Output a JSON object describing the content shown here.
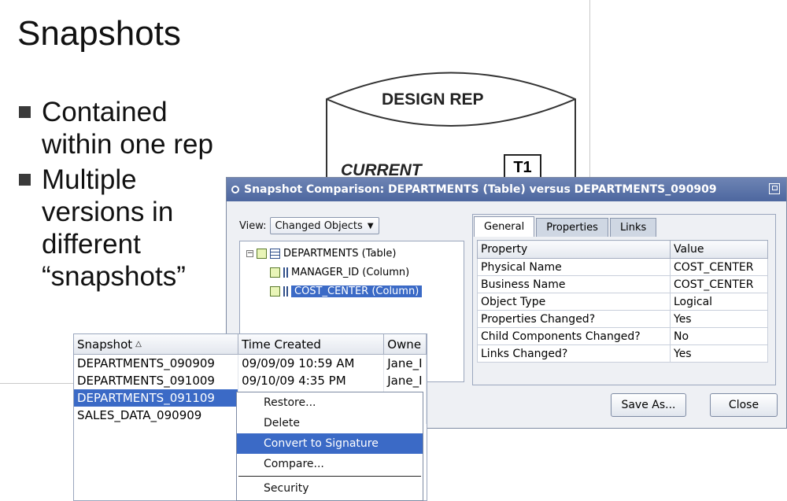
{
  "slide": {
    "title": "Snapshots",
    "bullets": [
      "Contained\nwithin one rep",
      "Multiple\nversions in\ndifferent\n“snapshots”"
    ],
    "cylinder_label": "DESIGN REP",
    "current_label": "CURRENT",
    "t1_label": "T1"
  },
  "dialog": {
    "title": "Snapshot Comparison: DEPARTMENTS (Table) versus DEPARTMENTS_090909",
    "view_label": "View:",
    "view_value": "Changed Objects",
    "tree": [
      {
        "label": "DEPARTMENTS (Table)"
      },
      {
        "label": "MANAGER_ID (Column)"
      },
      {
        "label": "COST_CENTER (Column)"
      }
    ],
    "tabs": [
      "General",
      "Properties",
      "Links"
    ],
    "table": {
      "headers": [
        "Property",
        "Value"
      ],
      "rows": [
        [
          "Physical Name",
          "COST_CENTER"
        ],
        [
          "Business Name",
          "COST_CENTER"
        ],
        [
          "Object Type",
          "Logical"
        ],
        [
          "Properties Changed?",
          "Yes"
        ],
        [
          "Child Components Changed?",
          "No"
        ],
        [
          "Links Changed?",
          "Yes"
        ]
      ]
    },
    "save_label": "Save As...",
    "close_label": "Close"
  },
  "snapshots": {
    "headers": [
      "Snapshot",
      "Time Created",
      "Owne"
    ],
    "rows": [
      [
        "DEPARTMENTS_090909",
        "09/09/09 10:59 AM",
        "Jane_I"
      ],
      [
        "DEPARTMENTS_091009",
        "09/10/09 4:35 PM",
        "Jane_I"
      ],
      [
        "DEPARTMENTS_091109",
        "",
        ""
      ],
      [
        "SALES_DATA_090909",
        "",
        ""
      ]
    ]
  },
  "context_menu": {
    "items": [
      "Restore...",
      "Delete",
      "Convert to Signature",
      "Compare...",
      "Security"
    ]
  }
}
